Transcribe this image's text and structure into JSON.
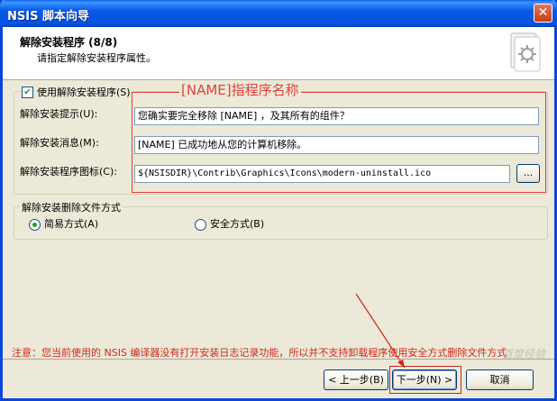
{
  "window": {
    "title": "NSIS 脚本向导",
    "close_glyph": "✕"
  },
  "header": {
    "title": "解除安装程序 (8/8)",
    "subtitle": "请指定解除安装程序属性。",
    "icon": "installer-gear-icon"
  },
  "uninstall_group": {
    "enable_label": "使用解除安装程序(S)",
    "enabled": true,
    "prompt_label": "解除安装提示(U):",
    "prompt_value": "您确实要完全移除 [NAME] ，及其所有的组件？",
    "message_label": "解除安装消息(M):",
    "message_value": "[NAME] 已成功地从您的计算机移除。",
    "icon_label": "解除安装程序图标(C):",
    "icon_value": "${NSISDIR}\\Contrib\\Graphics\\Icons\\modern-uninstall.ico",
    "browse_label": "..."
  },
  "mode_group": {
    "title": "解除安装删除文件方式",
    "simple_label": "简易方式(A)",
    "safe_label": "安全方式(B)",
    "selected": "simple"
  },
  "annotation": "[NAME]指程序名称",
  "warning": "注意：您当前使用的 NSIS 编译器没有打开安装日志记录功能，所以并不支持卸载程序使用安全方式删除文件方式",
  "watermark": "百度经验",
  "buttons": {
    "back": "< 上一步(B)",
    "next": "下一步(N) >",
    "cancel": "取消"
  },
  "colors": {
    "accent": "#0758e6",
    "annotation_red": "#e0403a"
  }
}
